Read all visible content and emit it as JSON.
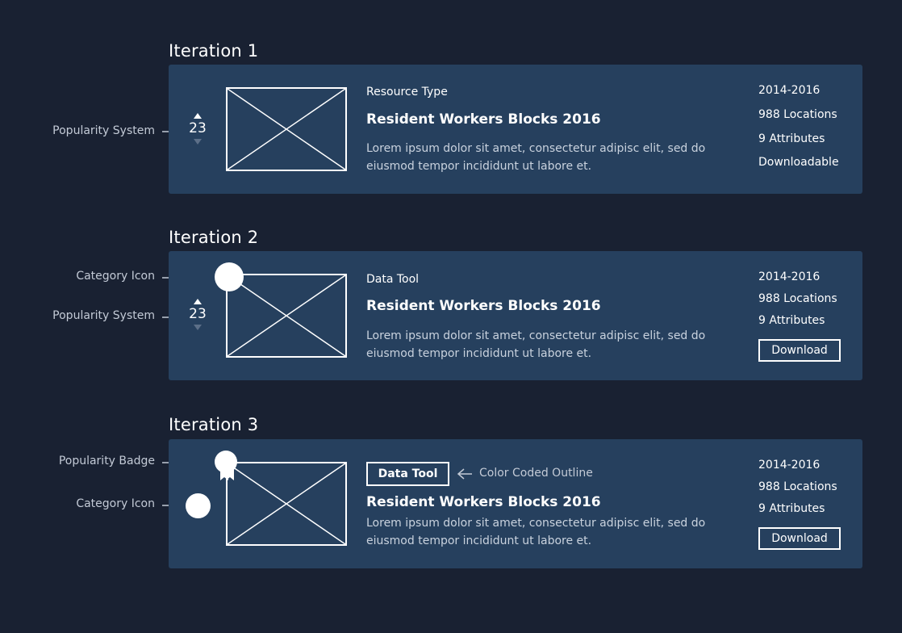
{
  "colors": {
    "background": "#192132",
    "card": "#26405e",
    "annotation_text": "#c3cad6",
    "description_text": "#c9d2de"
  },
  "iterations": [
    {
      "title": "Iteration 1",
      "vote_count": "23",
      "resource_type": "Resource Type",
      "resource_title": "Resident Workers Blocks 2016",
      "description": "Lorem ipsum dolor sit amet, consectetur adipisc elit, sed do eiusmod tempor incididunt ut labore et.",
      "meta": [
        "2014-2016",
        "988 Locations",
        "9 Attributes",
        "Downloadable"
      ],
      "annotations": {
        "popularity": "Popularity System"
      }
    },
    {
      "title": "Iteration 2",
      "vote_count": "23",
      "resource_type": "Data Tool",
      "resource_title": "Resident Workers Blocks 2016",
      "description": "Lorem ipsum dolor sit amet, consectetur adipisc elit, sed do eiusmod tempor incididunt ut labore et.",
      "meta": [
        "2014-2016",
        "988 Locations",
        "9 Attributes"
      ],
      "download_label": "Download",
      "annotations": {
        "category": "Category Icon",
        "popularity": "Popularity System"
      }
    },
    {
      "title": "Iteration 3",
      "tag_label": "Data Tool",
      "resource_title": "Resident Workers Blocks 2016",
      "description": "Lorem ipsum dolor sit amet, consectetur adipisc elit, sed do eiusmod tempor incididunt ut labore et.",
      "meta": [
        "2014-2016",
        "988 Locations",
        "9 Attributes"
      ],
      "download_label": "Download",
      "annotations": {
        "badge": "Popularity Badge",
        "category": "Category Icon",
        "outline": "Color Coded Outline"
      }
    }
  ]
}
